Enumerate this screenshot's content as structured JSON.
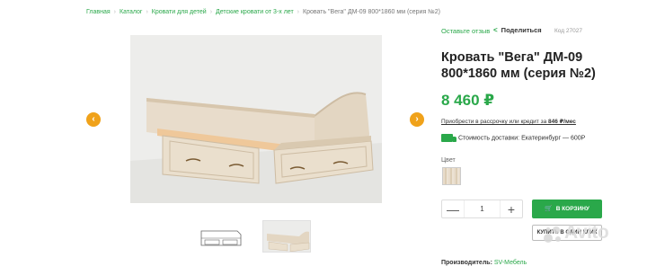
{
  "breadcrumb": [
    "Главная",
    "Каталог",
    "Кровати для детей",
    "Детские кровати от 3-х лет",
    "Кровать \"Вега\" ДМ-09 800*1860 мм (серия №2)"
  ],
  "gallery": {
    "prev_icon": "chevron-left-icon",
    "next_icon": "chevron-right-icon",
    "thumbnails": [
      "drawing",
      "photo"
    ]
  },
  "product": {
    "review_link": "Оставьте отзыв",
    "share_label": "Поделиться",
    "code": "Код 27027",
    "title": "Кровать \"Вега\" ДМ-09 800*1860 мм (серия №2)",
    "price": "8 460 ₽",
    "credit_prefix": "Приобрести в рассрочку или кредит за ",
    "credit_amount": "846 ₽/мес",
    "delivery": "Стоимость доставки: Екатеринбург — 600Р",
    "color_label": "Цвет",
    "quantity": "1",
    "cart_button": "В КОРЗИНУ",
    "one_click_button": "КУПИТЬ В ОДИН КЛИК",
    "manufacturer_label": "Производитель:",
    "manufacturer_value": "SV-Мебель"
  },
  "watermark": "Avito",
  "colors": {
    "accent": "#2aa84a",
    "arrow": "#f0a21a"
  }
}
